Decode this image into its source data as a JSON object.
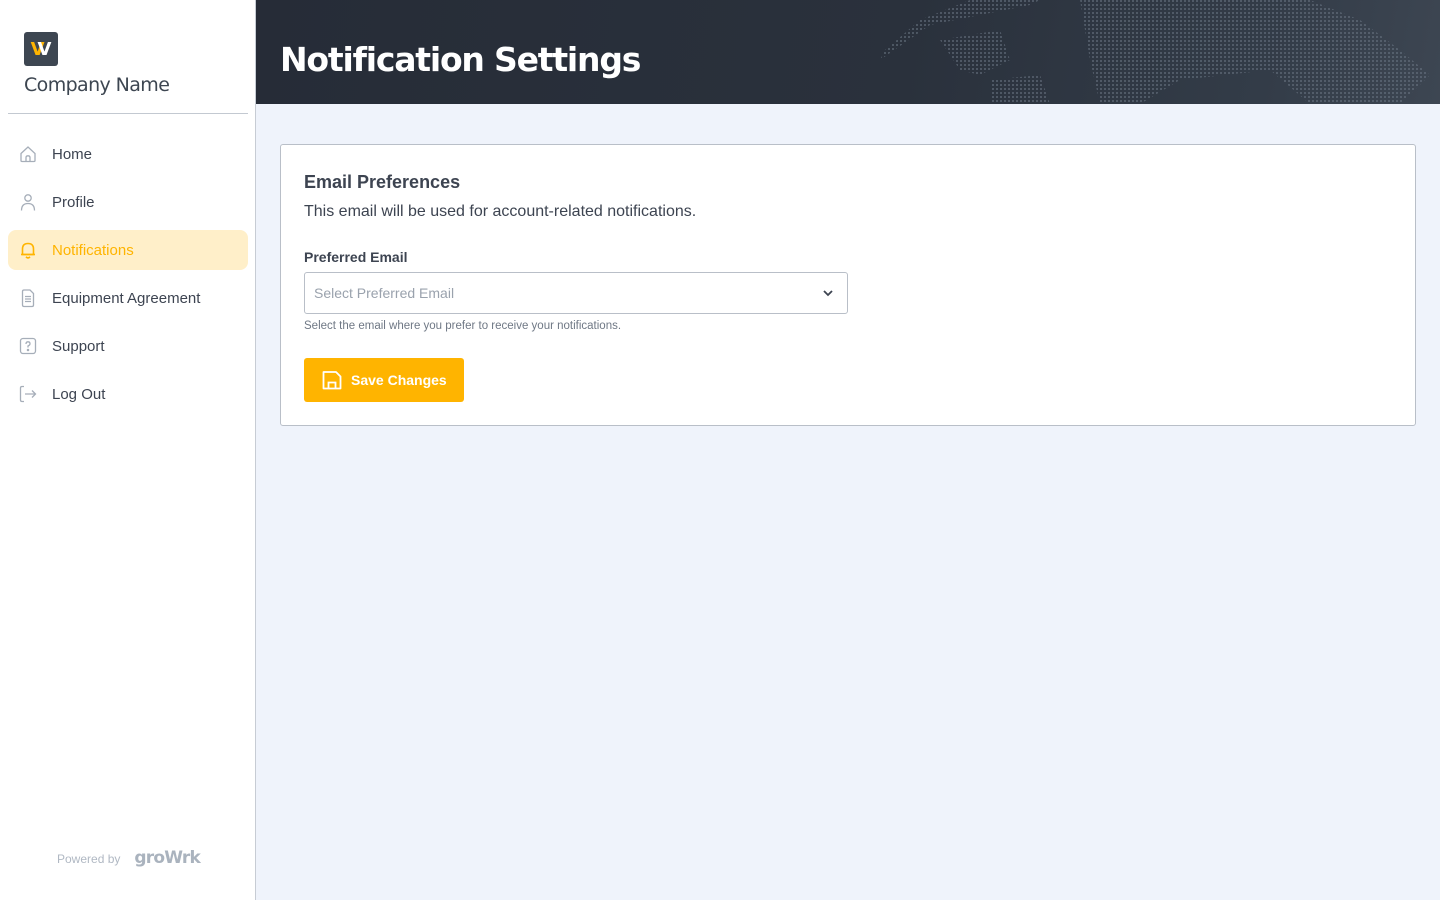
{
  "brand": {
    "logo_letter": "W",
    "company_name": "Company Name",
    "colors": {
      "accent": "#ffb400",
      "logo_bg": "#3d4651"
    }
  },
  "sidebar": {
    "items": [
      {
        "label": "Home",
        "icon": "home-icon",
        "active": false
      },
      {
        "label": "Profile",
        "icon": "user-icon",
        "active": false
      },
      {
        "label": "Notifications",
        "icon": "bell-icon",
        "active": true
      },
      {
        "label": "Equipment Agreement",
        "icon": "document-icon",
        "active": false
      },
      {
        "label": "Support",
        "icon": "question-icon",
        "active": false
      },
      {
        "label": "Log Out",
        "icon": "logout-icon",
        "active": false
      }
    ],
    "footer": {
      "powered_by": "Powered by",
      "vendor": "groWrk"
    }
  },
  "header": {
    "title": "Notification Settings"
  },
  "email_preferences": {
    "title": "Email Preferences",
    "description": "This email will be used for account-related notifications.",
    "preferred_email": {
      "label": "Preferred Email",
      "placeholder": "Select Preferred Email",
      "value": "",
      "hint": "Select the email where you prefer to receive your notifications."
    },
    "save_label": "Save Changes"
  }
}
